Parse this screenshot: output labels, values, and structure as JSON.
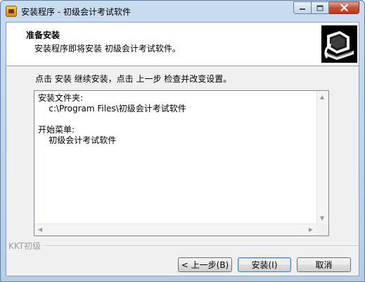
{
  "window": {
    "title": "安装程序 - 初级会计考试软件",
    "app_icon": "installer-box-icon",
    "controls": {
      "minimize": "minimize-icon",
      "maximize": "maximize-icon",
      "close": "close-icon"
    },
    "close_color": "#c7503a"
  },
  "header": {
    "title": "准备安装",
    "subtitle": "安装程序即将安装 初级会计考试软件。",
    "image": "computer-install-icon"
  },
  "body": {
    "description": "点击 安装 继续安装，点击 上一步 检查并改变设置。",
    "memo_lines": [
      "安装文件夹:",
      "    c:\\Program Files\\初级会计考试软件",
      "",
      "开始菜单:",
      "    初级会计考试软件"
    ]
  },
  "footer": {
    "brand": "KKT初级",
    "buttons": {
      "back": "< 上一步(B)",
      "install": "安装(I)",
      "cancel": "取消"
    }
  }
}
